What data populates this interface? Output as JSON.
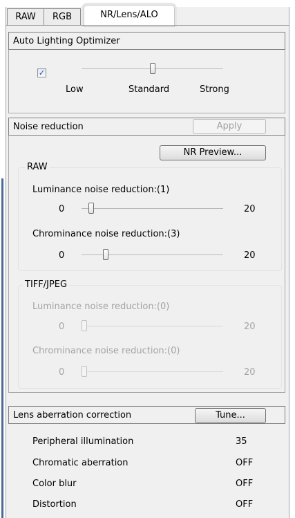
{
  "tabs": [
    {
      "label": "RAW"
    },
    {
      "label": "RGB"
    },
    {
      "label": "NR/Lens/ALO"
    }
  ],
  "alo": {
    "header": "Auto Lighting Optimizer",
    "checked": true,
    "checkbox_glyph": "✓",
    "setting": "Standard",
    "scale_labels": [
      "Low",
      "Standard",
      "Strong"
    ]
  },
  "noise": {
    "header": "Noise reduction",
    "apply_label": "Apply",
    "preview_label": "NR Preview...",
    "raw": {
      "title": "RAW",
      "luminance_label": "Luminance noise reduction:(1)",
      "luminance_min": "0",
      "luminance_max": "20",
      "luminance_value": 1,
      "chrominance_label": "Chrominance noise reduction:(3)",
      "chrominance_min": "0",
      "chrominance_max": "20",
      "chrominance_value": 3
    },
    "tiff": {
      "title": "TIFF/JPEG",
      "luminance_label": "Luminance noise reduction:(0)",
      "luminance_min": "0",
      "luminance_max": "20",
      "luminance_value": 0,
      "chrominance_label": "Chrominance noise reduction:(0)",
      "chrominance_min": "0",
      "chrominance_max": "20",
      "chrominance_value": 0
    }
  },
  "lens": {
    "header": "Lens aberration correction",
    "tune_label": "Tune...",
    "rows": [
      {
        "name": "Peripheral illumination",
        "value": "35"
      },
      {
        "name": "Chromatic aberration",
        "value": "OFF"
      },
      {
        "name": "Color blur",
        "value": "OFF"
      },
      {
        "name": "Distortion",
        "value": "OFF"
      }
    ]
  },
  "colors": {
    "panel_bg": "#f0f0f0",
    "edge_accent": "#4a6a9a",
    "disabled_text": "#a3a3a3"
  }
}
